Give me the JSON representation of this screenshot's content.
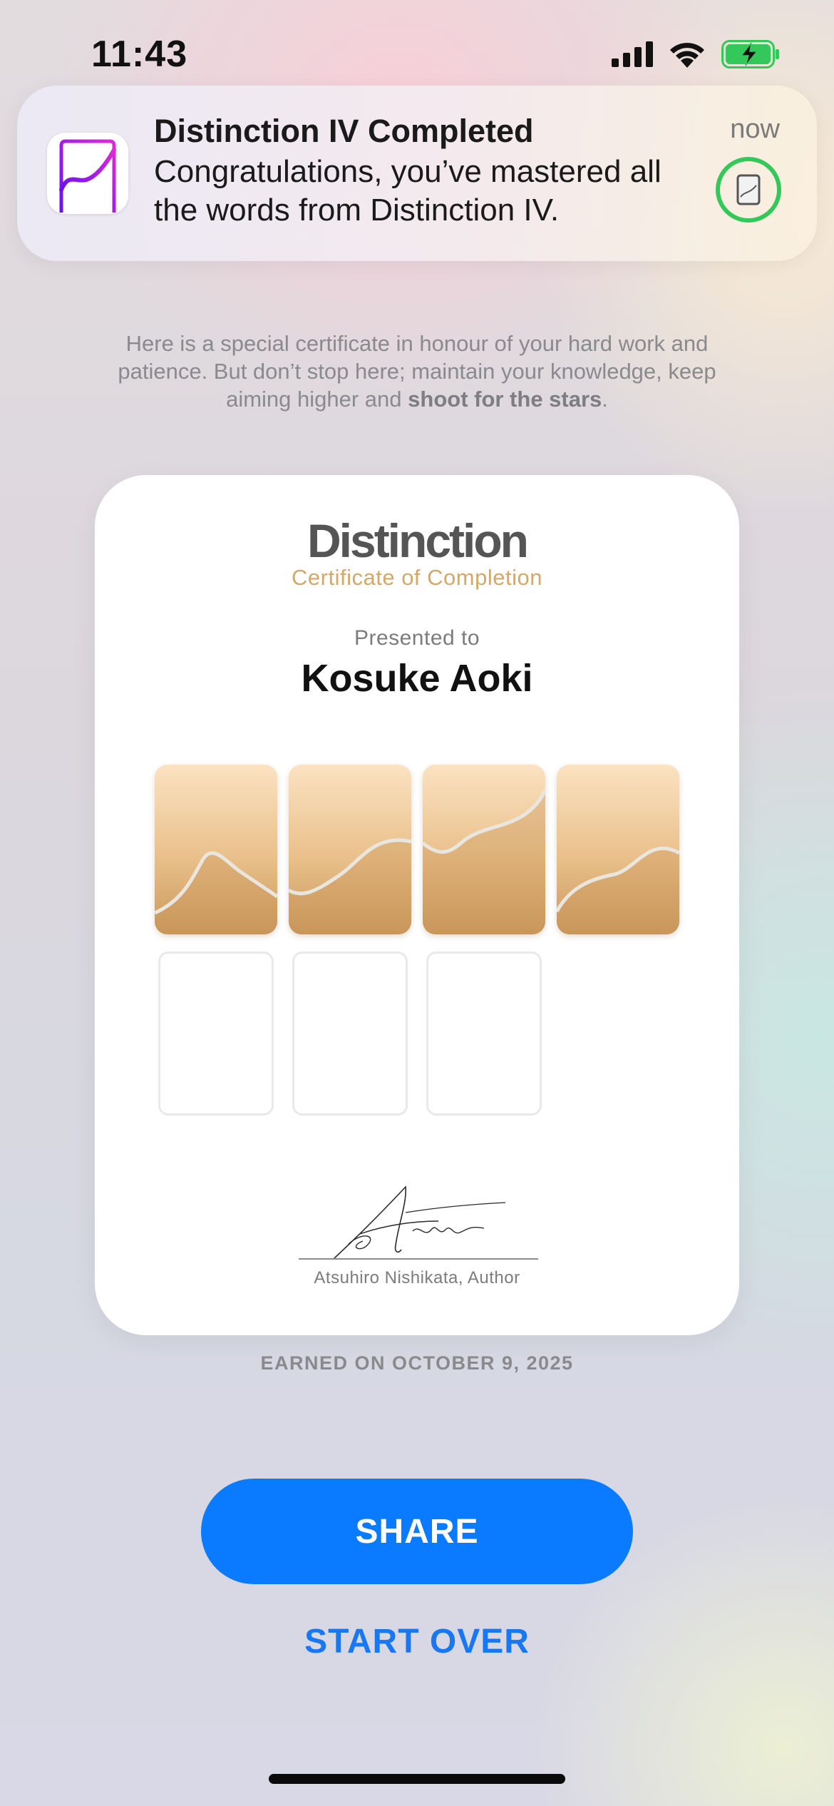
{
  "status_bar": {
    "time": "11:43"
  },
  "notification": {
    "title": "Distinction IV Completed",
    "body": "Congratulations, you’ve mastered all the words from Distinction IV.",
    "time": "now"
  },
  "intro": {
    "text": "Here is a special certificate in honour of your hard work and patience. But don’t stop here; maintain your knowledge, keep aiming higher and ",
    "emphasis": "shoot for the stars",
    "end": "."
  },
  "certificate": {
    "brand": "Distinction",
    "subtitle": "Certificate of Completion",
    "presented_label": "Presented to",
    "recipient": "Kosuke Aoki",
    "badges_earned": 4,
    "badges_remaining": 3,
    "signer": "Atsuhiro Nishikata, Author"
  },
  "earned_label": "EARNED ON OCTOBER 9, 2025",
  "actions": {
    "share": "SHARE",
    "start_over": "START OVER"
  },
  "colors": {
    "accent_blue": "#0a7bff",
    "gold": "#d4a76a",
    "battery_green": "#34c759"
  }
}
